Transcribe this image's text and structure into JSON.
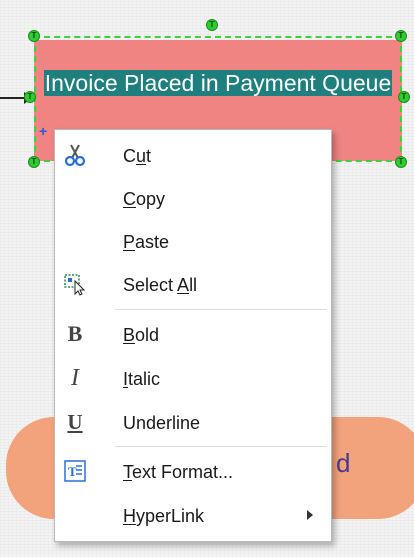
{
  "canvas": {
    "selected_shape": {
      "text": "Invoice Placed in Payment Queue",
      "fill": "#f08482",
      "text_highlight": "#1f7f7f",
      "selection_color": "#3bd23b",
      "handle_label": "T"
    },
    "lower_shape": {
      "text": "d",
      "fill": "#f2a37c"
    }
  },
  "context_menu": {
    "items": [
      {
        "id": "cut",
        "before": "C",
        "accel": "u",
        "after": "t",
        "icon": "scissors-icon"
      },
      {
        "id": "copy",
        "before": "",
        "accel": "C",
        "after": "opy",
        "icon": null
      },
      {
        "id": "paste",
        "before": "",
        "accel": "P",
        "after": "aste",
        "icon": null
      },
      {
        "id": "select-all",
        "before": "Select ",
        "accel": "A",
        "after": "ll",
        "icon": "select-all-icon"
      },
      {
        "id": "bold",
        "before": "",
        "accel": "B",
        "after": "old",
        "icon": "bold-icon",
        "glyph": "B"
      },
      {
        "id": "italic",
        "before": "",
        "accel": "I",
        "after": "talic",
        "icon": "italic-icon",
        "glyph": "I"
      },
      {
        "id": "underline",
        "before": "Underline",
        "accel": "",
        "after": "",
        "icon": "underline-icon",
        "glyph": "U"
      },
      {
        "id": "text-format",
        "before": "",
        "accel": "T",
        "after": "ext Format...",
        "icon": "text-format-icon"
      },
      {
        "id": "hyperlink",
        "before": "",
        "accel": "H",
        "after": "yperLink",
        "icon": null,
        "submenu": true
      }
    ]
  }
}
